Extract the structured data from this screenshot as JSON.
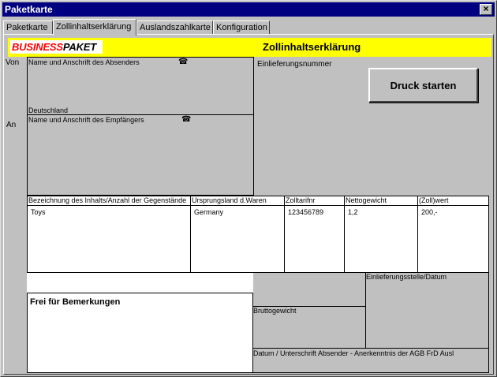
{
  "window": {
    "title": "Paketkarte",
    "close_glyph": "×"
  },
  "tabs": [
    {
      "label": "Paketkarte"
    },
    {
      "label": "Zollinhaltserklärung"
    },
    {
      "label": "Auslandszahlkarte"
    },
    {
      "label": "Konfiguration"
    }
  ],
  "header": {
    "brand_part1": "BUSINESS",
    "brand_part2": "PAKET",
    "title": "Zollinhaltserklärung",
    "bar_color": "#ffff00",
    "brand_red": "#ff0000"
  },
  "sender": {
    "side_label": "Von",
    "field_label": "Name und Anschrift des Absenders",
    "country": "Deutschland",
    "icon": "phone-icon"
  },
  "recipient": {
    "side_label": "An",
    "field_label": "Name und Anschrift des Empfängers",
    "icon": "phone-icon"
  },
  "einlieferungsnummer_label": "Einlieferungsnummer",
  "print_button": "Druck starten",
  "table": {
    "headers": [
      "Bezeichnung des Inhalts/Anzahl der Gegenstände",
      "Ursprungsland d.Waren",
      "Zolltarifnr",
      "Nettogewicht",
      "(Zoll)wert"
    ],
    "row": [
      "Toys",
      "Germany",
      "123456789",
      "1,2",
      "200,-"
    ]
  },
  "remarks_label": "Frei für Bemerkungen",
  "einlieferungsstelle_label": "Einlieferungsstelle/Datum",
  "bruttogewicht_label": "Bruttogewicht",
  "signature_label": "Datum / Unterschrift Absender - Anerkenntnis der AGB FrD Ausl"
}
